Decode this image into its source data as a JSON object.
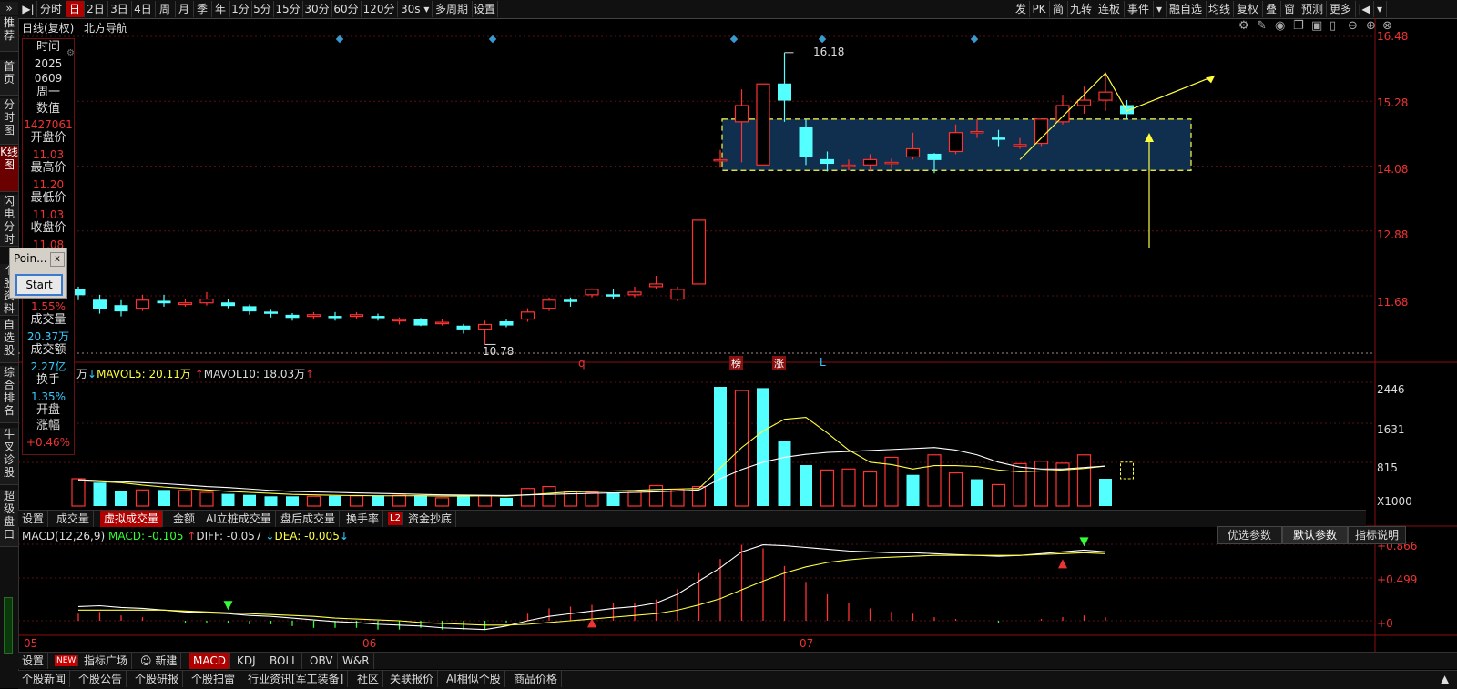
{
  "toolbar": {
    "items": [
      "分时",
      "日",
      "2日",
      "3日",
      "4日",
      "周",
      "月",
      "季",
      "年",
      "1分",
      "5分",
      "15分",
      "30分",
      "60分",
      "120分",
      "30s",
      "多周期",
      "设置"
    ],
    "right_items": [
      "发",
      "PK",
      "简",
      "九转",
      "连板",
      "事件",
      "融自选",
      "均线",
      "复权",
      "叠",
      "窗",
      "预测",
      "更多"
    ]
  },
  "sidebar": {
    "items": [
      "推荐",
      "首页",
      "分时图",
      "K线图",
      "闪电分时",
      "个股资料",
      "自选股",
      "综合排名",
      "牛叉诊股",
      "超级盘口"
    ]
  },
  "chart_header": {
    "title": "日线(复权)",
    "name": "北方导航"
  },
  "info_panel": {
    "time_label": "时间",
    "year": "2025",
    "date": "0609",
    "weekday": "周一",
    "value_label": "数值",
    "value": "1427061",
    "open_label": "开盘价",
    "open": "11.03",
    "high_label": "最高价",
    "high": "11.20",
    "low_label": "最低价",
    "low": "11.03",
    "close_label": "收盘价",
    "close": "11.08",
    "pct": "1.55%",
    "vol_label": "成交量",
    "vol": "20.37万",
    "amt_label": "成交额",
    "amt": "2.27亿",
    "turnover_label": "换手",
    "turnover": "1.35%",
    "open_gain_label1": "开盘",
    "open_gain_label2": "涨幅",
    "open_gain": "+0.46%"
  },
  "popup": {
    "title": "Poin...",
    "close": "x",
    "button": "Start"
  },
  "price_axis": [
    "16.48",
    "15.28",
    "14.08",
    "12.88",
    "11.68"
  ],
  "price_annotations": {
    "high": "16.18",
    "low": "10.78"
  },
  "event_marks": [
    "q",
    "榜",
    "涨",
    "L"
  ],
  "volume_legend": {
    "unit": "万",
    "mavol5": "MAVOL5: 20.11万",
    "mavol10": "MAVOL10: 18.03万"
  },
  "volume_axis": [
    "2446",
    "1631",
    "815",
    "X1000"
  ],
  "indicator_tabs": [
    "设置",
    "成交量",
    "虚拟成交量",
    "金额",
    "AI立桩成交量",
    "盘后成交量",
    "换手率",
    "L2",
    "资金抄底"
  ],
  "macd_legend": {
    "name": "MACD(12,26,9)",
    "macd": "MACD: -0.105",
    "diff": "DIFF: -0.057",
    "dea": "DEA: -0.005"
  },
  "macd_buttons": [
    "优选参数",
    "默认参数",
    "指标说明"
  ],
  "macd_axis": [
    "0.866",
    "0.499",
    "0"
  ],
  "date_axis": [
    "05",
    "06",
    "07"
  ],
  "bottom_tabs": [
    "设置",
    "NEW",
    "指标广场",
    "新建",
    "MACD",
    "KDJ",
    "BOLL",
    "OBV",
    "W&R"
  ],
  "news_tabs": [
    "个股新闻",
    "个股公告",
    "个股研报",
    "个股扫雷",
    "行业资讯[军工装备]",
    "社区",
    "关联报价",
    "AI相似个股",
    "商品价格"
  ],
  "colors": {
    "up": "#ff3232",
    "down": "#54ffff",
    "ma5": "#ffff40",
    "ma10": "#ffffff",
    "box": "#103050",
    "accent": "#b00000"
  },
  "chart_data": {
    "type": "candlestick",
    "title": "北方导航 日线(复权)",
    "x_ticks": [
      "05",
      "06",
      "07"
    ],
    "ylim": [
      10.6,
      16.6
    ],
    "candles": [
      {
        "o": 11.8,
        "c": 11.7,
        "h": 11.85,
        "l": 11.6
      },
      {
        "o": 11.6,
        "c": 11.45,
        "h": 11.7,
        "l": 11.35
      },
      {
        "o": 11.5,
        "c": 11.4,
        "h": 11.6,
        "l": 11.3
      },
      {
        "o": 11.45,
        "c": 11.6,
        "h": 11.7,
        "l": 11.4
      },
      {
        "o": 11.58,
        "c": 11.55,
        "h": 11.7,
        "l": 11.48
      },
      {
        "o": 11.52,
        "c": 11.55,
        "h": 11.62,
        "l": 11.48
      },
      {
        "o": 11.55,
        "c": 11.62,
        "h": 11.75,
        "l": 11.5
      },
      {
        "o": 11.55,
        "c": 11.5,
        "h": 11.62,
        "l": 11.45
      },
      {
        "o": 11.48,
        "c": 11.4,
        "h": 11.52,
        "l": 11.33
      },
      {
        "o": 11.38,
        "c": 11.36,
        "h": 11.42,
        "l": 11.28
      },
      {
        "o": 11.32,
        "c": 11.28,
        "h": 11.36,
        "l": 11.22
      },
      {
        "o": 11.3,
        "c": 11.33,
        "h": 11.38,
        "l": 11.25
      },
      {
        "o": 11.3,
        "c": 11.28,
        "h": 11.38,
        "l": 11.22
      },
      {
        "o": 11.3,
        "c": 11.33,
        "h": 11.38,
        "l": 11.26
      },
      {
        "o": 11.3,
        "c": 11.28,
        "h": 11.35,
        "l": 11.22
      },
      {
        "o": 11.22,
        "c": 11.24,
        "h": 11.28,
        "l": 11.15
      },
      {
        "o": 11.24,
        "c": 11.14,
        "h": 11.27,
        "l": 11.12
      },
      {
        "o": 11.17,
        "c": 11.19,
        "h": 11.25,
        "l": 11.13
      },
      {
        "o": 11.12,
        "c": 11.05,
        "h": 11.16,
        "l": 10.98
      },
      {
        "o": 11.05,
        "c": 11.15,
        "h": 11.22,
        "l": 10.78
      },
      {
        "o": 11.2,
        "c": 11.14,
        "h": 11.24,
        "l": 11.1
      },
      {
        "o": 11.25,
        "c": 11.38,
        "h": 11.45,
        "l": 11.2
      },
      {
        "o": 11.45,
        "c": 11.6,
        "h": 11.65,
        "l": 11.4
      },
      {
        "o": 11.6,
        "c": 11.6,
        "h": 11.65,
        "l": 11.48
      },
      {
        "o": 11.7,
        "c": 11.8,
        "h": 11.82,
        "l": 11.65
      },
      {
        "o": 11.7,
        "c": 11.7,
        "h": 11.8,
        "l": 11.62
      },
      {
        "o": 11.7,
        "c": 11.75,
        "h": 11.85,
        "l": 11.65
      },
      {
        "o": 11.85,
        "c": 11.9,
        "h": 12.05,
        "l": 11.8
      },
      {
        "o": 11.62,
        "c": 11.8,
        "h": 11.85,
        "l": 11.58
      },
      {
        "o": 11.9,
        "c": 13.08,
        "h": 13.08,
        "l": 11.9
      },
      {
        "o": 14.2,
        "c": 14.2,
        "h": 14.38,
        "l": 14.05
      },
      {
        "o": 14.9,
        "c": 15.2,
        "h": 15.5,
        "l": 14.15
      },
      {
        "o": 14.1,
        "c": 15.6,
        "h": 15.6,
        "l": 14.1
      },
      {
        "o": 15.6,
        "c": 15.3,
        "h": 16.18,
        "l": 14.9
      },
      {
        "o": 14.8,
        "c": 14.25,
        "h": 14.95,
        "l": 14.1
      },
      {
        "o": 14.2,
        "c": 14.13,
        "h": 14.35,
        "l": 13.98
      },
      {
        "o": 14.1,
        "c": 14.1,
        "h": 14.2,
        "l": 14.0
      },
      {
        "o": 14.1,
        "c": 14.2,
        "h": 14.3,
        "l": 14.0
      },
      {
        "o": 14.15,
        "c": 14.15,
        "h": 14.22,
        "l": 14.03
      },
      {
        "o": 14.25,
        "c": 14.4,
        "h": 14.7,
        "l": 14.2
      },
      {
        "o": 14.3,
        "c": 14.2,
        "h": 14.32,
        "l": 13.95
      },
      {
        "o": 14.35,
        "c": 14.7,
        "h": 14.85,
        "l": 14.3
      },
      {
        "o": 14.72,
        "c": 14.72,
        "h": 14.95,
        "l": 14.6
      },
      {
        "o": 14.6,
        "c": 14.6,
        "h": 14.75,
        "l": 14.45
      },
      {
        "o": 14.48,
        "c": 14.48,
        "h": 14.6,
        "l": 14.4
      },
      {
        "o": 14.5,
        "c": 14.95,
        "h": 14.95,
        "l": 14.45
      },
      {
        "o": 14.9,
        "c": 15.2,
        "h": 15.4,
        "l": 14.85
      },
      {
        "o": 15.2,
        "c": 15.3,
        "h": 15.55,
        "l": 15.05
      },
      {
        "o": 15.3,
        "c": 15.45,
        "h": 15.8,
        "l": 15.1
      },
      {
        "o": 15.2,
        "c": 15.05,
        "h": 15.3,
        "l": 14.95
      }
    ],
    "volume": [
      {
        "v": 560,
        "up": true
      },
      {
        "v": 480,
        "up": false
      },
      {
        "v": 300,
        "up": false
      },
      {
        "v": 330,
        "up": true
      },
      {
        "v": 330,
        "up": false
      },
      {
        "v": 320,
        "up": true
      },
      {
        "v": 280,
        "up": true
      },
      {
        "v": 250,
        "up": false
      },
      {
        "v": 230,
        "up": false
      },
      {
        "v": 200,
        "up": false
      },
      {
        "v": 200,
        "up": false
      },
      {
        "v": 200,
        "up": true
      },
      {
        "v": 210,
        "up": false
      },
      {
        "v": 210,
        "up": true
      },
      {
        "v": 220,
        "up": false
      },
      {
        "v": 220,
        "up": true
      },
      {
        "v": 220,
        "up": false
      },
      {
        "v": 170,
        "up": true
      },
      {
        "v": 200,
        "up": false
      },
      {
        "v": 210,
        "up": true
      },
      {
        "v": 170,
        "up": false
      },
      {
        "v": 360,
        "up": true
      },
      {
        "v": 400,
        "up": true
      },
      {
        "v": 290,
        "up": true
      },
      {
        "v": 280,
        "up": true
      },
      {
        "v": 280,
        "up": false
      },
      {
        "v": 280,
        "up": true
      },
      {
        "v": 420,
        "up": true
      },
      {
        "v": 340,
        "up": true
      },
      {
        "v": 400,
        "up": true
      },
      {
        "v": 2446,
        "up": false
      },
      {
        "v": 2370,
        "up": true
      },
      {
        "v": 2420,
        "up": false
      },
      {
        "v": 1340,
        "up": false
      },
      {
        "v": 840,
        "up": false
      },
      {
        "v": 740,
        "up": true
      },
      {
        "v": 760,
        "up": true
      },
      {
        "v": 700,
        "up": true
      },
      {
        "v": 1000,
        "up": true
      },
      {
        "v": 640,
        "up": false
      },
      {
        "v": 1050,
        "up": true
      },
      {
        "v": 680,
        "up": true
      },
      {
        "v": 550,
        "up": false
      },
      {
        "v": 440,
        "up": true
      },
      {
        "v": 870,
        "up": true
      },
      {
        "v": 920,
        "up": true
      },
      {
        "v": 880,
        "up": true
      },
      {
        "v": 1050,
        "up": true
      },
      {
        "v": 560,
        "up": false
      }
    ],
    "mavol5": [
      520,
      500,
      480,
      430,
      390,
      360,
      330,
      300,
      280,
      260,
      240,
      230,
      220,
      215,
      210,
      210,
      212,
      205,
      205,
      210,
      205,
      230,
      260,
      290,
      300,
      310,
      320,
      340,
      350,
      360,
      780,
      1200,
      1540,
      1780,
      1820,
      1500,
      1150,
      900,
      850,
      760,
      830,
      830,
      810,
      740,
      700,
      720,
      740,
      770,
      820
    ],
    "mavol10": [
      540,
      520,
      500,
      480,
      460,
      430,
      400,
      380,
      350,
      320,
      300,
      290,
      280,
      270,
      260,
      250,
      240,
      230,
      225,
      220,
      215,
      230,
      240,
      250,
      260,
      270,
      280,
      290,
      310,
      330,
      560,
      750,
      900,
      1000,
      1060,
      1100,
      1120,
      1140,
      1160,
      1180,
      1200,
      1150,
      1050,
      900,
      800,
      760,
      760,
      790,
      820
    ],
    "macd": {
      "diff": [
        0.16,
        0.17,
        0.15,
        0.14,
        0.12,
        0.1,
        0.09,
        0.08,
        0.06,
        0.05,
        0.03,
        0.01,
        -0.01,
        -0.02,
        -0.04,
        -0.05,
        -0.06,
        -0.08,
        -0.09,
        -0.1,
        -0.06,
        0.0,
        0.05,
        0.08,
        0.11,
        0.14,
        0.16,
        0.2,
        0.3,
        0.45,
        0.6,
        0.78,
        0.86,
        0.85,
        0.83,
        0.81,
        0.79,
        0.78,
        0.77,
        0.77,
        0.76,
        0.75,
        0.74,
        0.73,
        0.74,
        0.76,
        0.78,
        0.8,
        0.78
      ],
      "dea": [
        0.12,
        0.12,
        0.12,
        0.12,
        0.12,
        0.11,
        0.1,
        0.09,
        0.08,
        0.07,
        0.06,
        0.05,
        0.03,
        0.02,
        0.01,
        0.0,
        -0.02,
        -0.03,
        -0.04,
        -0.05,
        -0.05,
        -0.04,
        -0.02,
        0.0,
        0.02,
        0.04,
        0.06,
        0.08,
        0.12,
        0.18,
        0.25,
        0.35,
        0.45,
        0.54,
        0.61,
        0.66,
        0.69,
        0.71,
        0.72,
        0.73,
        0.74,
        0.74,
        0.74,
        0.74,
        0.74,
        0.75,
        0.76,
        0.77,
        0.76
      ],
      "hist": [
        0.08,
        0.1,
        0.06,
        0.04,
        0.0,
        -0.02,
        -0.02,
        -0.02,
        -0.04,
        -0.04,
        -0.06,
        -0.08,
        -0.08,
        -0.08,
        -0.1,
        -0.1,
        -0.08,
        -0.1,
        -0.1,
        -0.1,
        -0.02,
        0.08,
        0.14,
        0.16,
        0.18,
        0.2,
        0.2,
        0.24,
        0.36,
        0.54,
        0.7,
        0.86,
        0.82,
        0.62,
        0.44,
        0.3,
        0.2,
        0.14,
        0.1,
        0.08,
        0.04,
        0.02,
        0.0,
        -0.02,
        0.0,
        0.02,
        0.04,
        0.06,
        0.04
      ]
    }
  }
}
